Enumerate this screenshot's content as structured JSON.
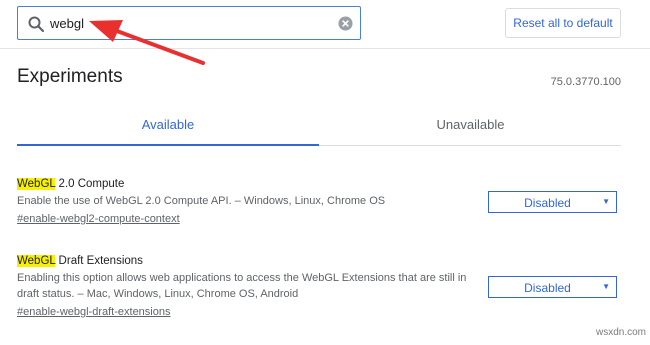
{
  "search": {
    "value": "webgl"
  },
  "header": {
    "reset_label": "Reset all to default"
  },
  "page": {
    "title": "Experiments",
    "version": "75.0.3770.100"
  },
  "tabs": [
    {
      "label": "Available",
      "active": true
    },
    {
      "label": "Unavailable",
      "active": false
    }
  ],
  "experiments": [
    {
      "name_highlight": "WebGL",
      "name_rest": " 2.0 Compute",
      "description": "Enable the use of WebGL 2.0 Compute API. – Windows, Linux, Chrome OS",
      "link": "#enable-webgl2-compute-context",
      "state": "Disabled"
    },
    {
      "name_highlight": "WebGL",
      "name_rest": " Draft Extensions",
      "description": "Enabling this option allows web applications to access the WebGL Extensions that are still in draft status. – Mac, Windows, Linux, Chrome OS, Android",
      "link": "#enable-webgl-draft-extensions",
      "state": "Disabled"
    }
  ],
  "watermark": "wsxdn.com",
  "colors": {
    "accent": "#3367d6",
    "highlight": "#f7f100",
    "annotation_arrow": "#e8312f"
  }
}
